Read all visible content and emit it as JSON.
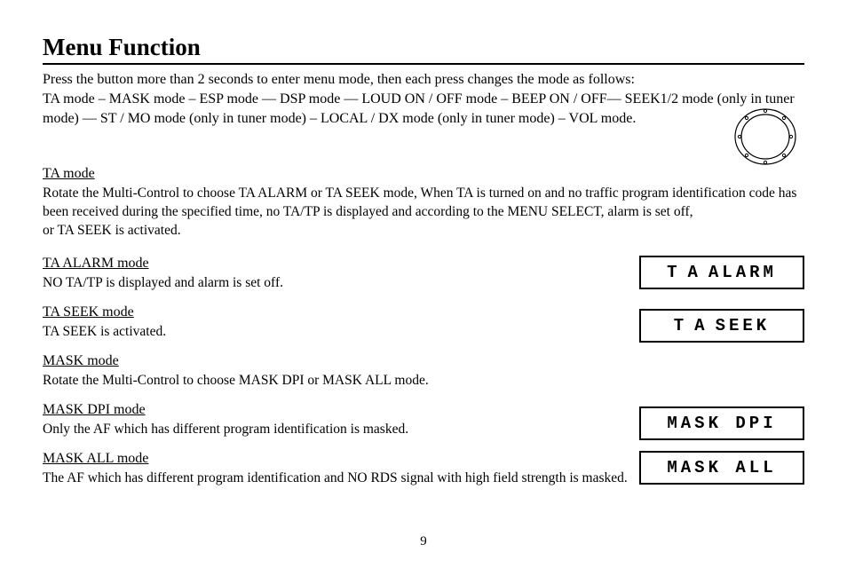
{
  "title": "Menu Function",
  "intro1": "Press the button more than 2 seconds to enter menu mode, then each press changes the mode as follows:",
  "intro2": "TA mode – MASK mode – ESP mode ― DSP mode ― LOUD ON / OFF mode – BEEP ON / OFF― SEEK1/2 mode (only in tuner mode) ― ST / MO mode (only in tuner mode) – LOCAL / DX mode (only in tuner mode) – VOL mode.",
  "s1_head": "TA mode",
  "s1_body": "Rotate the Multi-Control to choose TA ALARM or TA SEEK mode, When TA is turned on and no traffic program identification code has been received during the specified time, no TA/TP is displayed and according to the MENU SELECT, alarm is set off,\nor TA SEEK is activated.",
  "s2_head": "TA ALARM mode",
  "s2_body": "NO TA/TP is displayed and alarm is set off.",
  "s3_head": "TA SEEK mode",
  "s3_body": "TA SEEK is activated.",
  "s4_head": "MASK mode",
  "s4_body": "Rotate the Multi-Control to choose MASK DPI or MASK ALL mode.",
  "s5_head": "MASK DPI mode",
  "s5_body": "Only the AF which has different program identification is masked.",
  "s6_head": "MASK ALL mode",
  "s6_body": "The AF which has different program identification and NO RDS signal with high field strength is masked.",
  "pagenum": "9",
  "lcd1a": "TA",
  "lcd1b": "ALARM",
  "lcd2a": "TA",
  "lcd2b": "SEEK",
  "lcd3a": "MASK",
  "lcd3b": "DPI",
  "lcd4a": "MASK",
  "lcd4b": "ALL"
}
